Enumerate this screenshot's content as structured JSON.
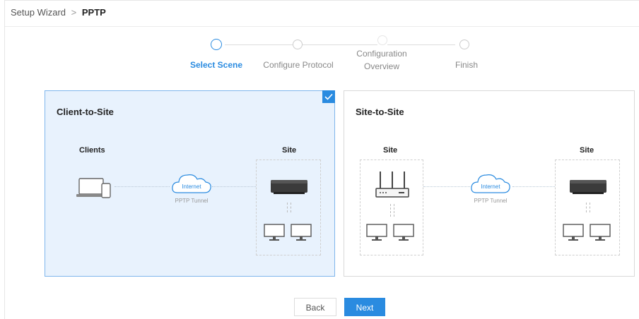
{
  "breadcrumb": {
    "parent": "Setup Wizard",
    "separator": ">",
    "current": "PPTP"
  },
  "steps": [
    {
      "label": "Select Scene",
      "active": true
    },
    {
      "label": "Configure Protocol",
      "active": false
    },
    {
      "label": "Configuration",
      "label2": "Overview",
      "active": false
    },
    {
      "label": "Finish",
      "active": false
    }
  ],
  "cards": {
    "client_to_site": {
      "title": "Client-to-Site",
      "left_label": "Clients",
      "right_label": "Site",
      "cloud_label": "Internet",
      "tunnel_label": "PPTP Tunnel",
      "selected": true
    },
    "site_to_site": {
      "title": "Site-to-Site",
      "left_label": "Site",
      "right_label": "Site",
      "cloud_label": "Internet",
      "tunnel_label": "PPTP Tunnel",
      "selected": false
    }
  },
  "buttons": {
    "back": "Back",
    "next": "Next"
  },
  "colors": {
    "accent": "#2a8be0",
    "selected_bg": "#e8f2fd"
  }
}
